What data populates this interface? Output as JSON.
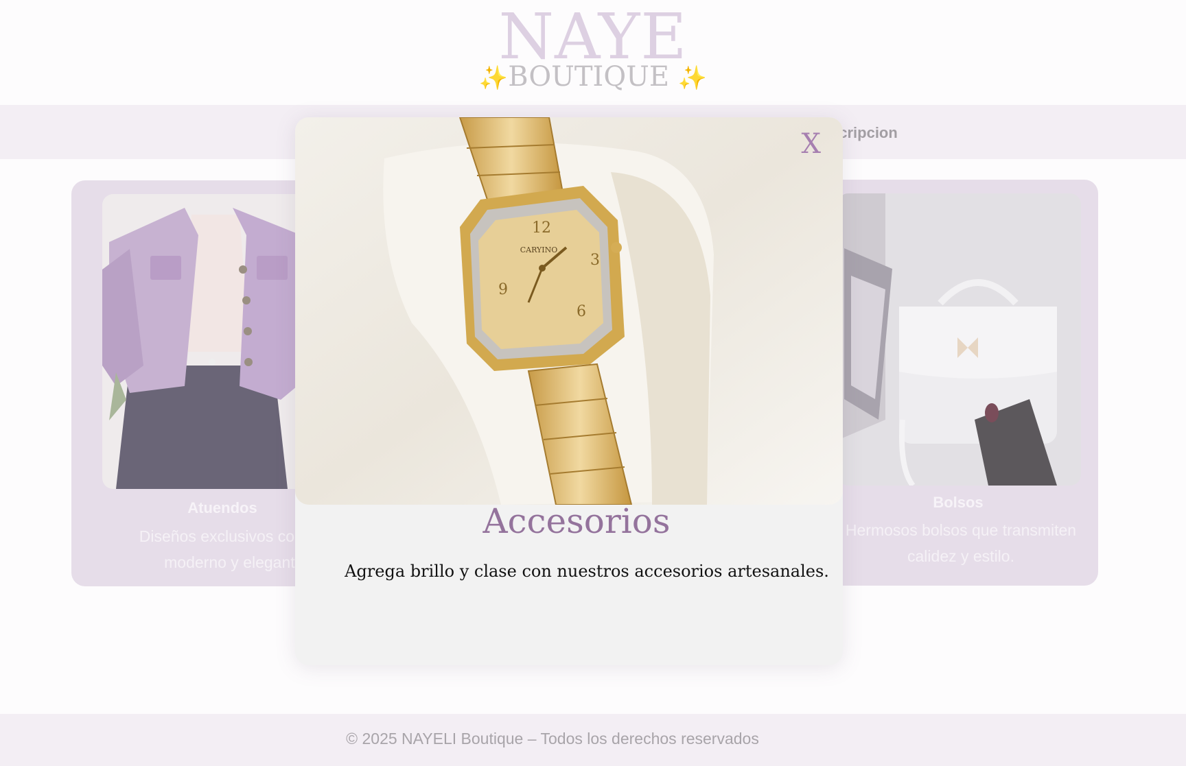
{
  "header": {
    "logo_main": "NAYE",
    "logo_sub": "BOUTIQUE",
    "sparkle": "✨"
  },
  "nav": {
    "visible_link": "scripcion"
  },
  "cards": {
    "left": {
      "title": "Atuendos",
      "description_line1": "Diseños exclusivos con un l",
      "description_line2": "moderno y elegante."
    },
    "right": {
      "title": "Bolsos",
      "description_line1": "Hermosos bolsos que transmiten",
      "description_line2": "calidez y estilo."
    }
  },
  "modal": {
    "close_label": "X",
    "title": "Accesorios",
    "description": "Agrega brillo y clase con nuestros accesorios artesanales.",
    "watch_brand": "CARYINO"
  },
  "footer": {
    "text": "© 2025 NAYELI Boutique – Todos los derechos reservados"
  },
  "colors": {
    "accent": "#94739c",
    "card_bg": "#e6dde9",
    "nav_bg": "#f3eef4",
    "gold": "#d8b867"
  }
}
